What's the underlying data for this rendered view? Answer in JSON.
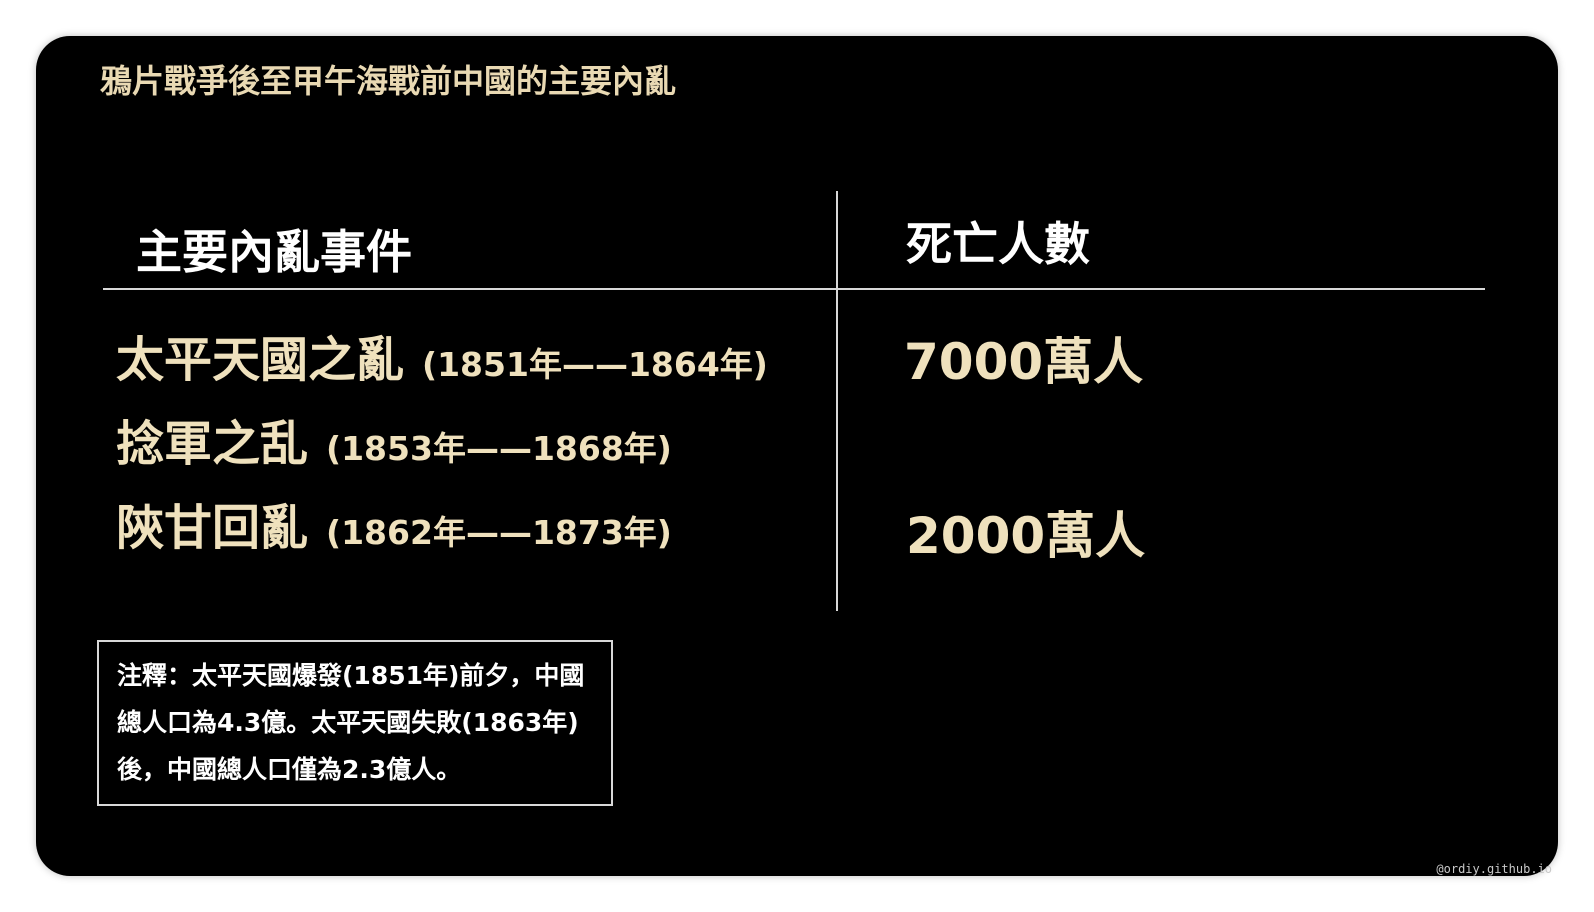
{
  "title": "鴉片戰爭後至甲午海戰前中國的主要內亂",
  "table": {
    "headers": {
      "event": "主要內亂事件",
      "deaths": "死亡人數"
    },
    "rows": [
      {
        "name": "太平天國之亂",
        "years": "(1851年——1864年)"
      },
      {
        "name": "捻軍之乱",
        "years": "(1853年——1868年)"
      },
      {
        "name": "陝甘回亂",
        "years": "(1862年——1873年)"
      }
    ],
    "deaths": [
      "7000萬人",
      "2000萬人"
    ]
  },
  "note": "注釋：太平天國爆發(1851年)前夕，中國總人口為4.3億。太平天國失敗(1863年)後，中國總人口僅為2.3億人。",
  "watermark": "@ordiy.github.io",
  "colors": {
    "background": "#000000",
    "title": "#e9d9b3",
    "content": "#efe1bd",
    "header": "#ffffff",
    "rule": "#d8d8d8"
  }
}
